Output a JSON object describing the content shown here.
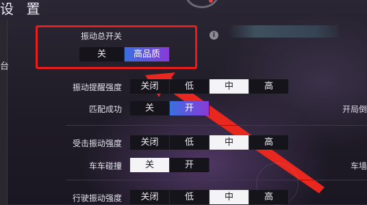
{
  "header": {
    "title": "设 置"
  },
  "left_nav": {
    "char": "台"
  },
  "master": {
    "label": "振动总开关",
    "options": [
      "关",
      "高品质"
    ],
    "selected": 1
  },
  "rows": [
    {
      "key": "drive_prompt",
      "label": "振动提醒强度",
      "options": [
        "关闭",
        "低",
        "中",
        "高"
      ],
      "selected": 2
    },
    {
      "key": "match_success",
      "label": "匹配成功",
      "options": [
        "关",
        "开"
      ],
      "selected": 1
    },
    {
      "key": "hit_strength",
      "label": "受击振动强度",
      "options": [
        "关闭",
        "低",
        "中",
        "高"
      ],
      "selected": 2
    },
    {
      "key": "car_collision",
      "label": "车车碰撞",
      "options": [
        "关",
        "开"
      ],
      "selected": 0
    },
    {
      "key": "drive_strength",
      "label": "行驶振动强度",
      "options": [
        "关闭",
        "低",
        "中",
        "高"
      ],
      "selected": 2
    }
  ],
  "right_labels": {
    "top": "开局倒",
    "bottom": "车墙"
  },
  "info_icon": "i",
  "colors": {
    "annotation": "#ea1c1c",
    "gradient_start": "#3a6fe0",
    "gradient_end": "#8a3ad6"
  }
}
